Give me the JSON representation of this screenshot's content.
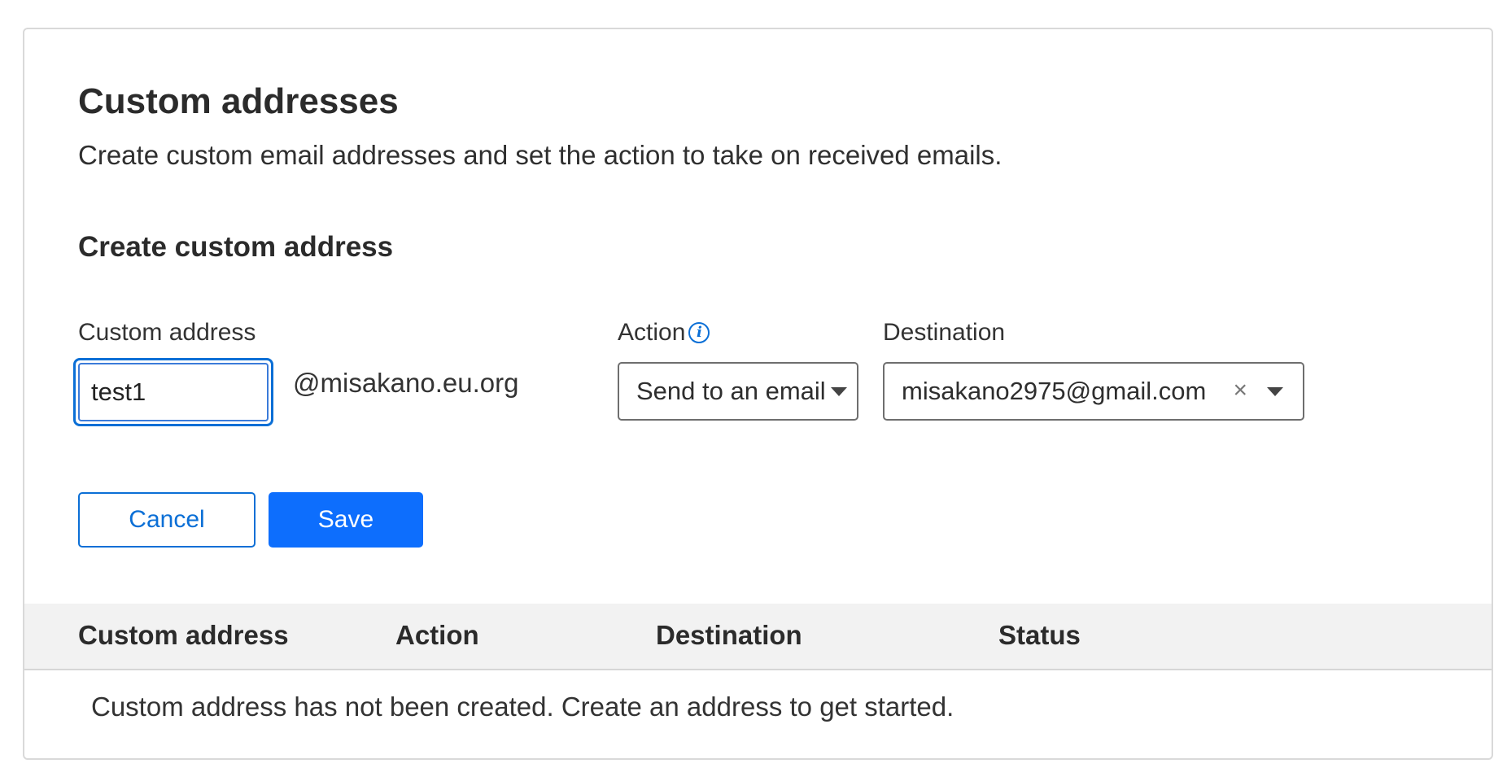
{
  "header": {
    "title": "Custom addresses",
    "description": "Create custom email addresses and set the action to take on received emails."
  },
  "form": {
    "section_title": "Create custom address",
    "custom_address": {
      "label": "Custom address",
      "value": "test1",
      "domain_suffix": "@misakano.eu.org"
    },
    "action": {
      "label": "Action",
      "info_icon": "info-icon",
      "selected": "Send to an email"
    },
    "destination": {
      "label": "Destination",
      "selected": "misakano2975@gmail.com",
      "clear_icon": "close-icon"
    },
    "cancel_label": "Cancel",
    "save_label": "Save"
  },
  "table": {
    "columns": [
      "Custom address",
      "Action",
      "Destination",
      "Status"
    ],
    "empty_message": "Custom address has not been created. Create an address to get started."
  },
  "colors": {
    "accent": "#0d6efd",
    "link": "#0b6fd6",
    "table_header_bg": "#f2f2f2"
  }
}
